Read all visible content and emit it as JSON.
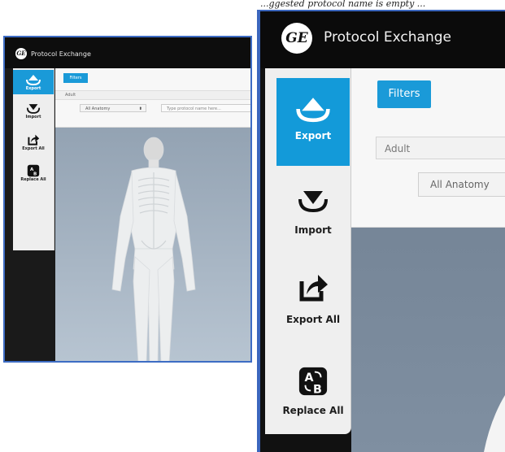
{
  "banner_text": "...ggested protocol name is empty ...",
  "app": {
    "title": "Protocol Exchange",
    "logo_text": "GE"
  },
  "sidebar": {
    "items": [
      {
        "label": "Export",
        "icon": "export-icon",
        "active": true
      },
      {
        "label": "Import",
        "icon": "import-icon",
        "active": false
      },
      {
        "label": "Export All",
        "icon": "export-all-icon",
        "active": false
      },
      {
        "label": "Replace All",
        "icon": "replace-all-icon",
        "active": false
      }
    ]
  },
  "filters": {
    "button_label": "Filters",
    "patient_type": "Adult",
    "anatomy_select": "All Anatomy",
    "search_placeholder": "Type protocol name here..."
  },
  "colors": {
    "accent": "#1a9ad8",
    "titlebar": "#0b0b0b",
    "sidebar_bg": "#efefef",
    "workspace": "#7f8fa1"
  }
}
